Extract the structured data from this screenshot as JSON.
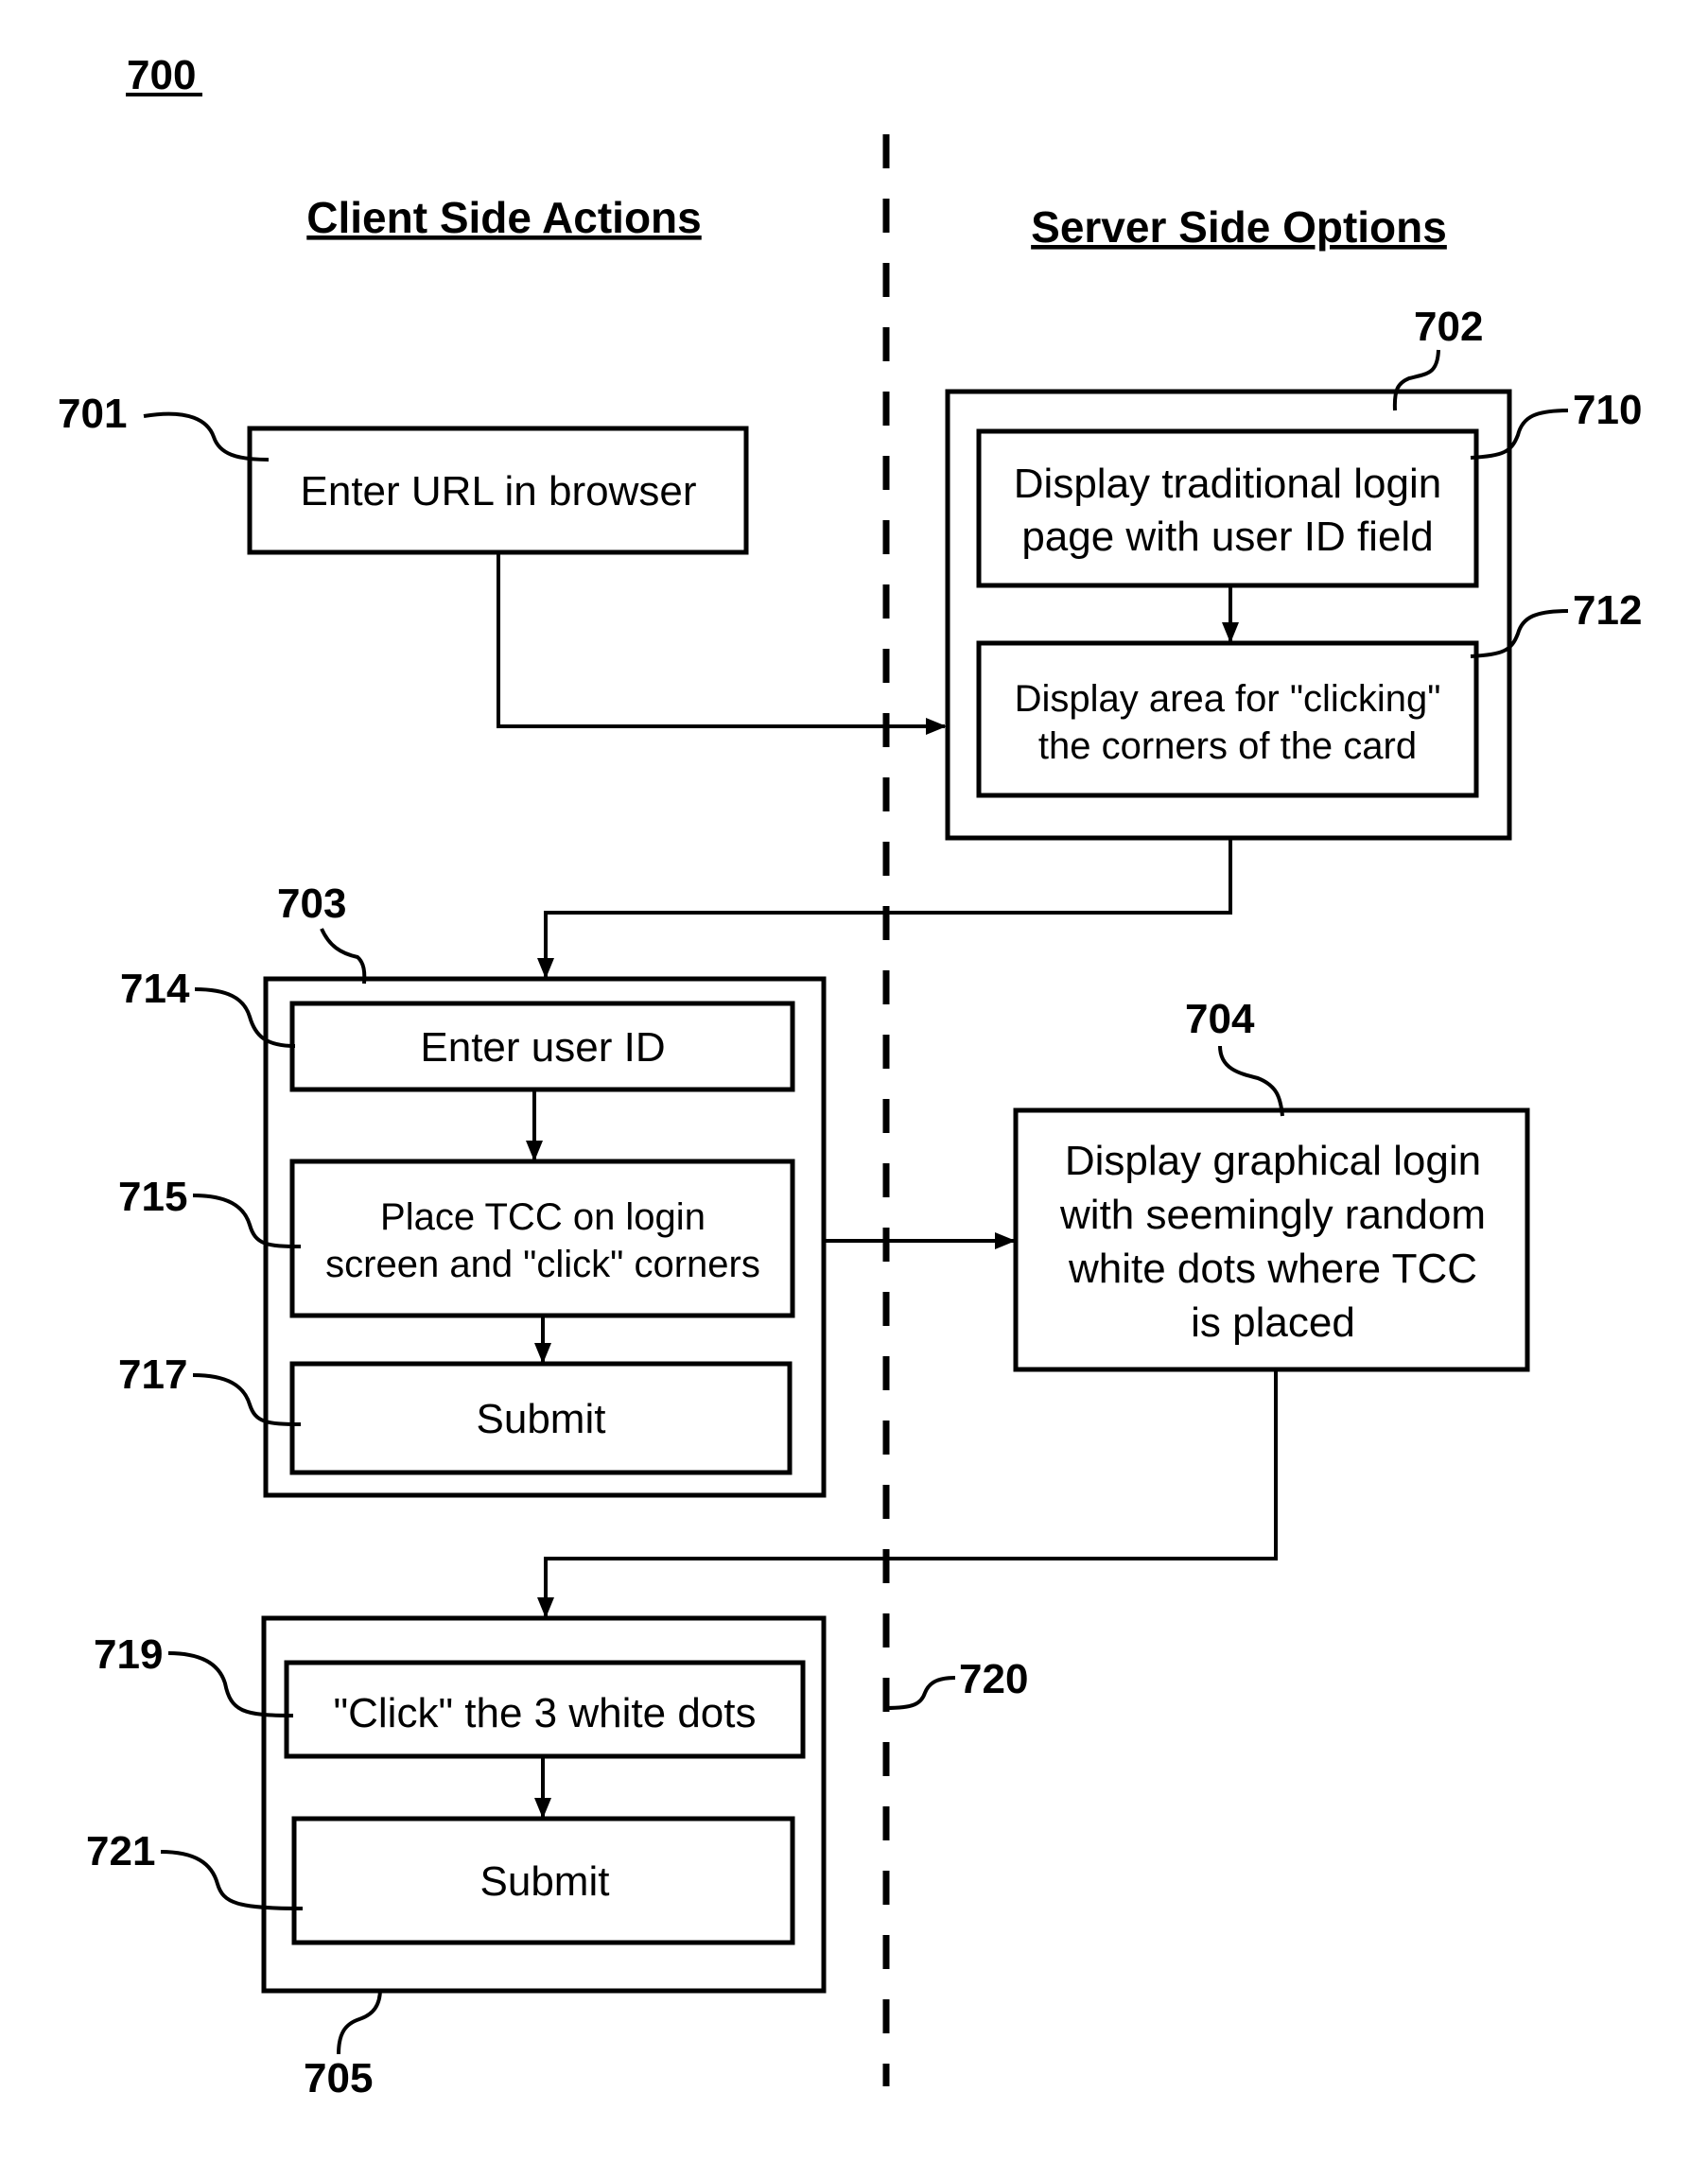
{
  "figure": {
    "number": "700",
    "divider_ref": "720"
  },
  "columns": {
    "client": "Client Side Actions",
    "server": "Server Side Options"
  },
  "blocks": {
    "b701": {
      "ref": "701",
      "lines": [
        "Enter URL in browser"
      ]
    },
    "b702": {
      "ref": "702"
    },
    "b710": {
      "ref": "710",
      "lines": [
        "Display traditional login",
        "page with user ID field"
      ]
    },
    "b712": {
      "ref": "712",
      "lines": [
        "Display area for \"clicking\"",
        "the corners of the card"
      ]
    },
    "b703": {
      "ref": "703"
    },
    "b714": {
      "ref": "714",
      "lines": [
        "Enter user ID"
      ]
    },
    "b715": {
      "ref": "715",
      "lines": [
        "Place TCC on login",
        "screen and \"click\" corners"
      ]
    },
    "b717": {
      "ref": "717",
      "lines": [
        "Submit"
      ]
    },
    "b704": {
      "ref": "704",
      "lines": [
        "Display graphical login",
        "with seemingly random",
        "white dots where TCC",
        "is placed"
      ]
    },
    "b705": {
      "ref": "705"
    },
    "b719": {
      "ref": "719",
      "lines": [
        "\"Click\" the 3 white dots"
      ]
    },
    "b721": {
      "ref": "721",
      "lines": [
        "Submit"
      ]
    }
  }
}
